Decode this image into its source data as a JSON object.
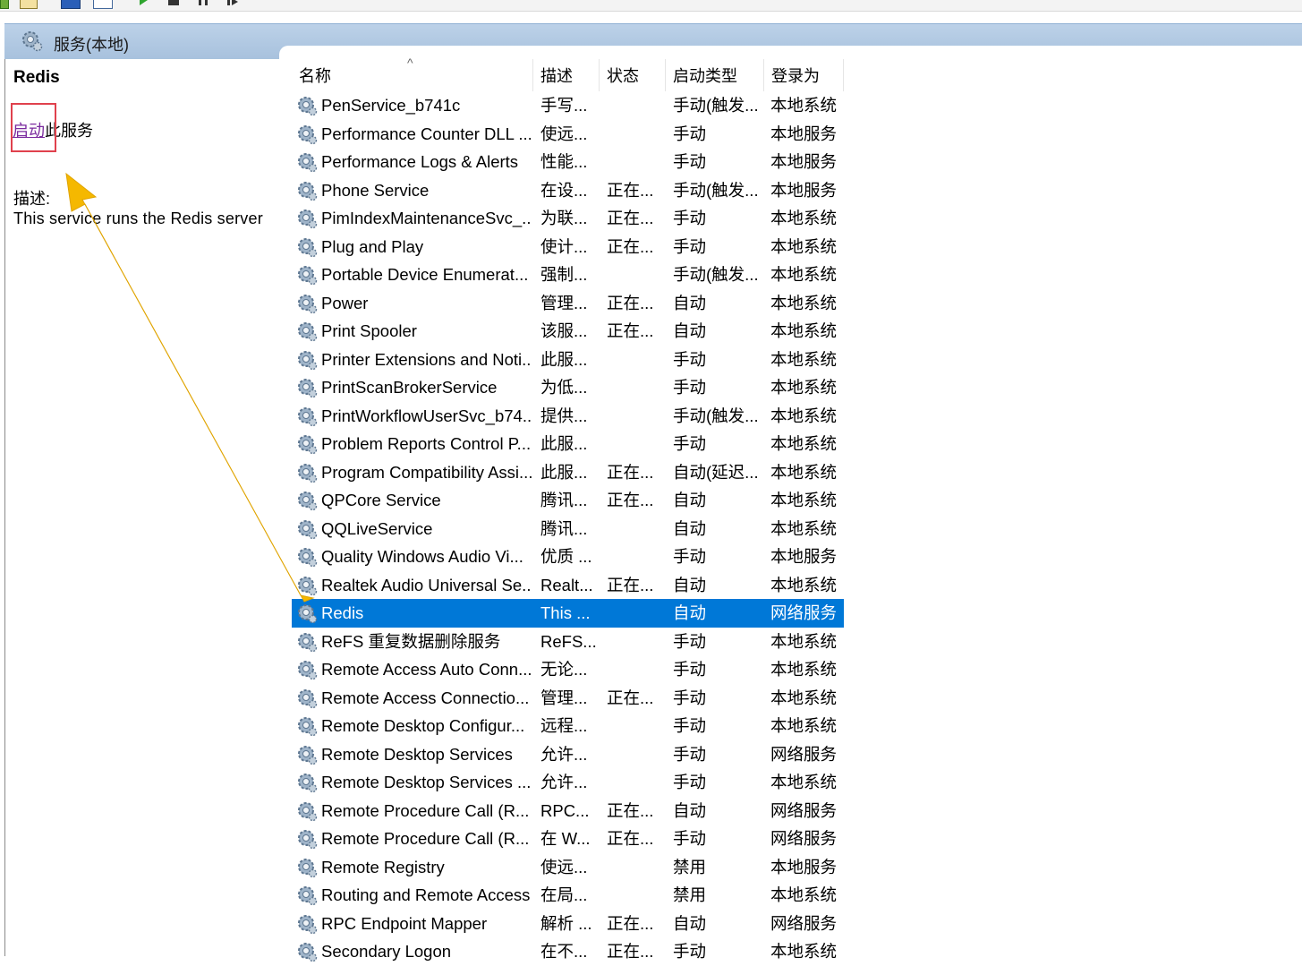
{
  "toolbar": {
    "icons": [
      "back-icon",
      "forward-icon",
      "properties-icon",
      "view-icon",
      "start-service-icon",
      "stop-service-icon",
      "pause-service-icon",
      "restart-service-icon"
    ]
  },
  "pane": {
    "title": "服务(本地)"
  },
  "details": {
    "service_name": "Redis",
    "start_link": "启动",
    "start_suffix": "此服务",
    "desc_label": "描述:",
    "desc_text": "This service runs the Redis server"
  },
  "columns": {
    "name": "名称",
    "desc": "描述",
    "status": "状态",
    "start_type": "启动类型",
    "logon": "登录为"
  },
  "rows": [
    {
      "name": "PenService_b741c",
      "desc": "手写...",
      "status": "",
      "start": "手动(触发...",
      "logon": "本地系统"
    },
    {
      "name": "Performance Counter DLL ...",
      "desc": "使远...",
      "status": "",
      "start": "手动",
      "logon": "本地服务"
    },
    {
      "name": "Performance Logs & Alerts",
      "desc": "性能...",
      "status": "",
      "start": "手动",
      "logon": "本地服务"
    },
    {
      "name": "Phone Service",
      "desc": "在设...",
      "status": "正在...",
      "start": "手动(触发...",
      "logon": "本地服务"
    },
    {
      "name": "PimIndexMaintenanceSvc_...",
      "desc": "为联...",
      "status": "正在...",
      "start": "手动",
      "logon": "本地系统"
    },
    {
      "name": "Plug and Play",
      "desc": "使计...",
      "status": "正在...",
      "start": "手动",
      "logon": "本地系统"
    },
    {
      "name": "Portable Device Enumerat...",
      "desc": "强制...",
      "status": "",
      "start": "手动(触发...",
      "logon": "本地系统"
    },
    {
      "name": "Power",
      "desc": "管理...",
      "status": "正在...",
      "start": "自动",
      "logon": "本地系统"
    },
    {
      "name": "Print Spooler",
      "desc": "该服...",
      "status": "正在...",
      "start": "自动",
      "logon": "本地系统"
    },
    {
      "name": "Printer Extensions and Noti...",
      "desc": "此服...",
      "status": "",
      "start": "手动",
      "logon": "本地系统"
    },
    {
      "name": "PrintScanBrokerService",
      "desc": "为低...",
      "status": "",
      "start": "手动",
      "logon": "本地系统"
    },
    {
      "name": "PrintWorkflowUserSvc_b74...",
      "desc": "提供...",
      "status": "",
      "start": "手动(触发...",
      "logon": "本地系统"
    },
    {
      "name": "Problem Reports Control P...",
      "desc": "此服...",
      "status": "",
      "start": "手动",
      "logon": "本地系统"
    },
    {
      "name": "Program Compatibility Assi...",
      "desc": "此服...",
      "status": "正在...",
      "start": "自动(延迟...",
      "logon": "本地系统"
    },
    {
      "name": "QPCore Service",
      "desc": "腾讯...",
      "status": "正在...",
      "start": "自动",
      "logon": "本地系统"
    },
    {
      "name": "QQLiveService",
      "desc": "腾讯...",
      "status": "",
      "start": "自动",
      "logon": "本地系统"
    },
    {
      "name": "Quality Windows Audio Vi...",
      "desc": "优质 ...",
      "status": "",
      "start": "手动",
      "logon": "本地服务"
    },
    {
      "name": "Realtek Audio Universal Se...",
      "desc": "Realt...",
      "status": "正在...",
      "start": "自动",
      "logon": "本地系统"
    },
    {
      "name": "Redis",
      "desc": "This ...",
      "status": "",
      "start": "自动",
      "logon": "网络服务",
      "selected": true
    },
    {
      "name": "ReFS 重复数据删除服务",
      "desc": "ReFS...",
      "status": "",
      "start": "手动",
      "logon": "本地系统"
    },
    {
      "name": "Remote Access Auto Conn...",
      "desc": "无论...",
      "status": "",
      "start": "手动",
      "logon": "本地系统"
    },
    {
      "name": "Remote Access Connectio...",
      "desc": "管理...",
      "status": "正在...",
      "start": "手动",
      "logon": "本地系统"
    },
    {
      "name": "Remote Desktop Configur...",
      "desc": "远程...",
      "status": "",
      "start": "手动",
      "logon": "本地系统"
    },
    {
      "name": "Remote Desktop Services",
      "desc": "允许...",
      "status": "",
      "start": "手动",
      "logon": "网络服务"
    },
    {
      "name": "Remote Desktop Services ...",
      "desc": "允许...",
      "status": "",
      "start": "手动",
      "logon": "本地系统"
    },
    {
      "name": "Remote Procedure Call (R...",
      "desc": "RPC...",
      "status": "正在...",
      "start": "自动",
      "logon": "网络服务"
    },
    {
      "name": "Remote Procedure Call (R...",
      "desc": "在 W...",
      "status": "正在...",
      "start": "手动",
      "logon": "网络服务"
    },
    {
      "name": "Remote Registry",
      "desc": "使远...",
      "status": "",
      "start": "禁用",
      "logon": "本地服务"
    },
    {
      "name": "Routing and Remote Access",
      "desc": "在局...",
      "status": "",
      "start": "禁用",
      "logon": "本地系统"
    },
    {
      "name": "RPC Endpoint Mapper",
      "desc": "解析 ...",
      "status": "正在...",
      "start": "自动",
      "logon": "网络服务"
    },
    {
      "name": "Secondary Logon",
      "desc": "在不...",
      "status": "正在...",
      "start": "手动",
      "logon": "本地系统"
    }
  ],
  "colors": {
    "selection": "#0078d7",
    "annotation_arrow": "#f5b800",
    "annotation_box": "#e0414d",
    "link": "#7a2a9e"
  }
}
